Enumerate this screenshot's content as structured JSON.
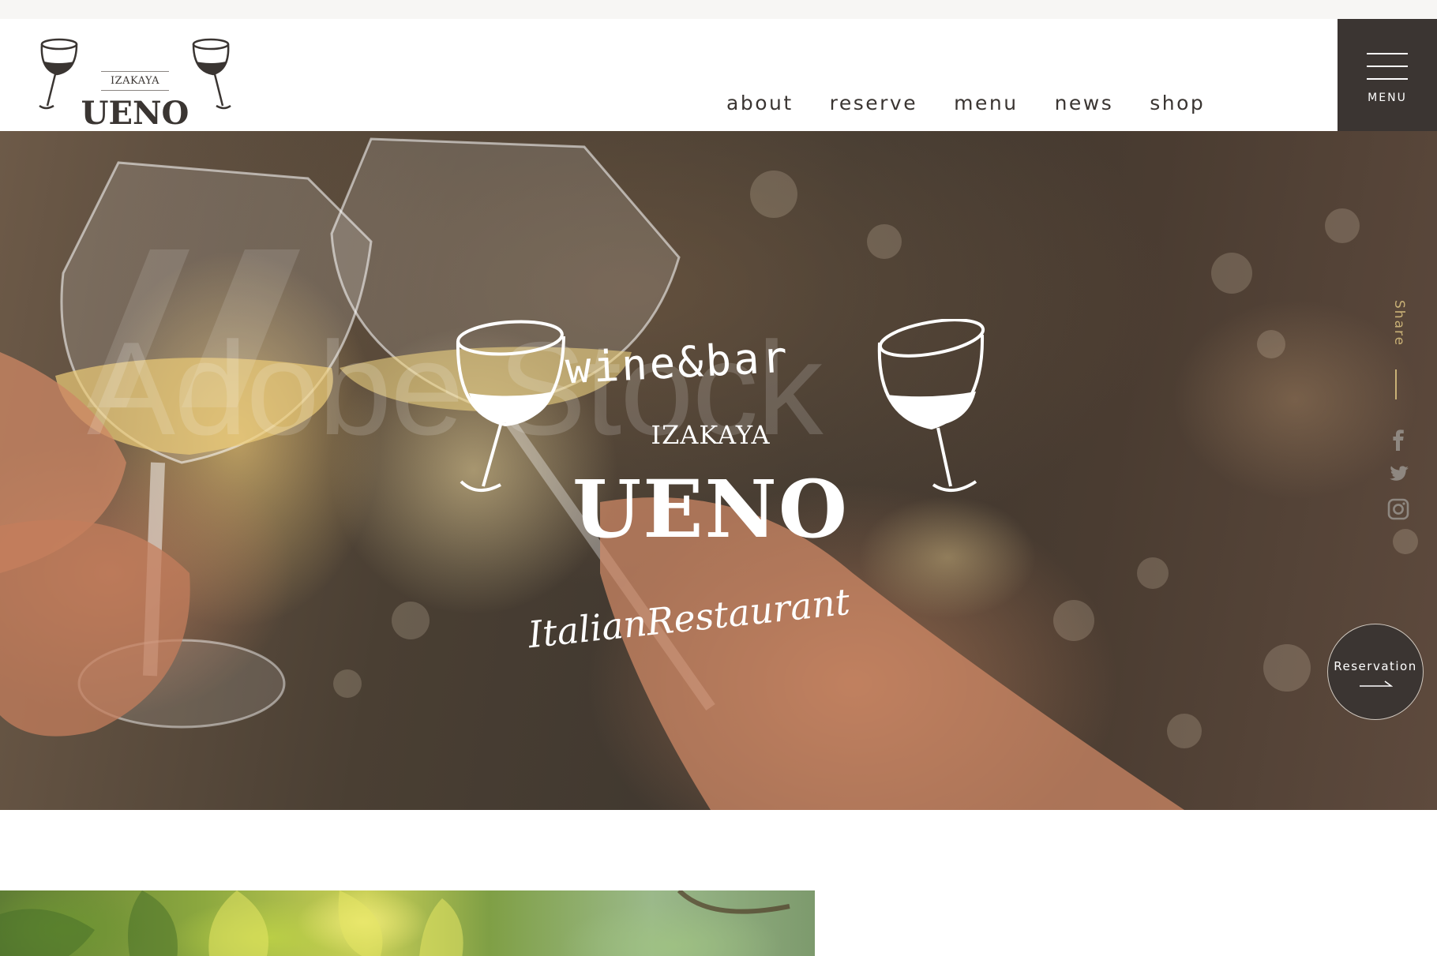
{
  "header": {
    "logo": {
      "sub": "IZAKAYA",
      "main": "UENO"
    },
    "nav": [
      {
        "label": "about"
      },
      {
        "label": "reserve"
      },
      {
        "label": "menu"
      },
      {
        "label": "news"
      },
      {
        "label": "shop"
      }
    ],
    "menu_label": "MENU"
  },
  "hero": {
    "watermark": "Adobe Stock",
    "brand": {
      "top": "wine&bar",
      "sub": "IZAKAYA",
      "main": "UENO",
      "script": "ItalianRestaurant"
    },
    "share_label": "Share",
    "social": [
      {
        "icon": "facebook-icon"
      },
      {
        "icon": "twitter-icon"
      },
      {
        "icon": "instagram-icon"
      }
    ],
    "reservation_label": "Reservation"
  },
  "colors": {
    "dark": "#3b3532",
    "accent": "#c9b176",
    "white": "#ffffff"
  }
}
